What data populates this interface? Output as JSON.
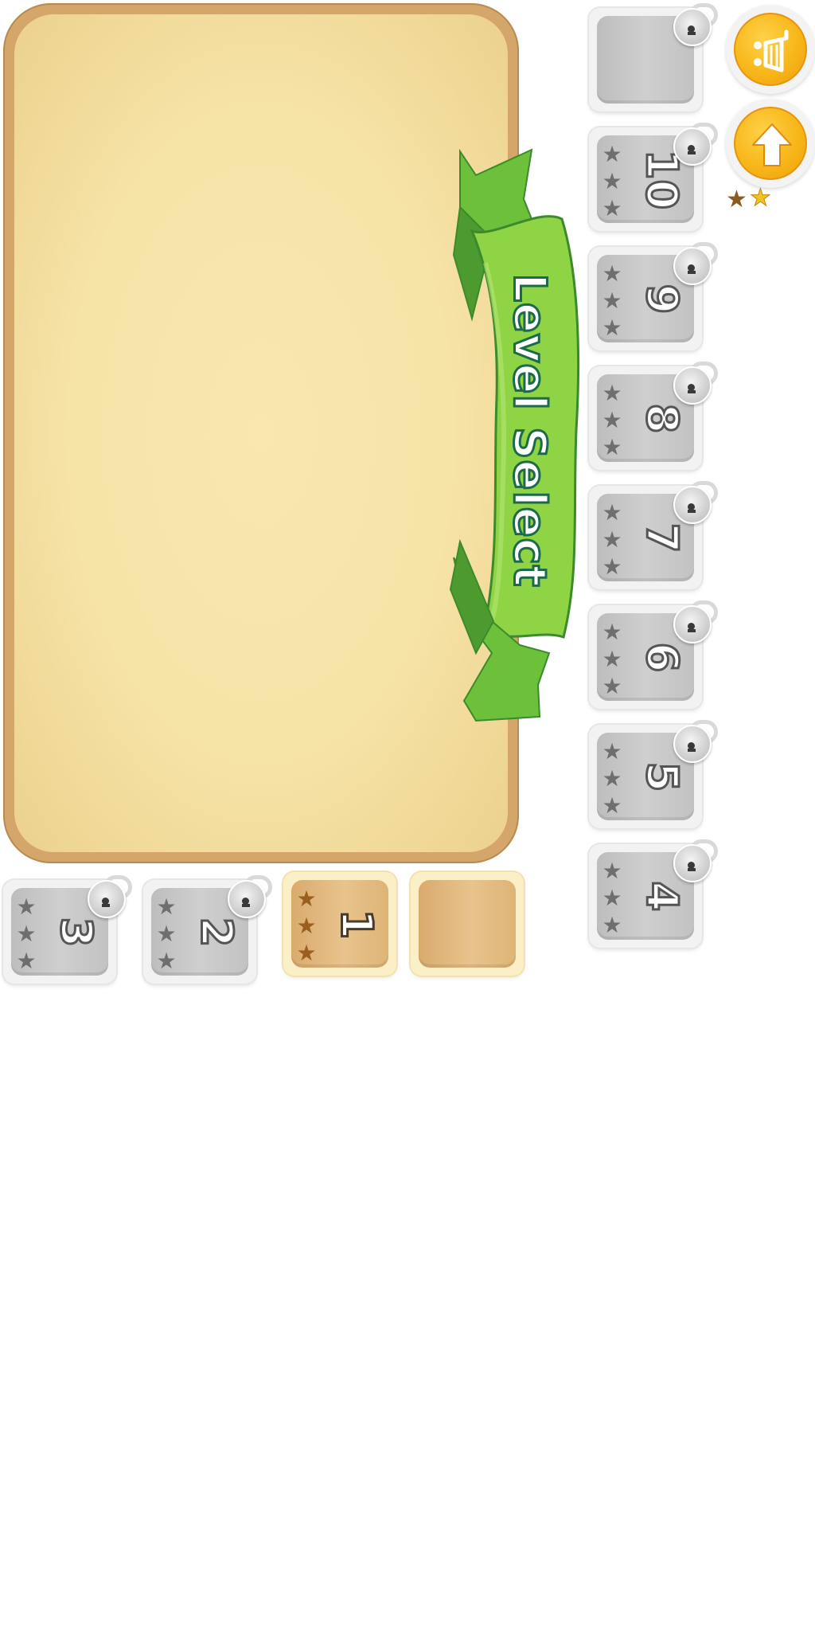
{
  "title": "Level Select",
  "levels": [
    {
      "number": "",
      "locked": true,
      "stars_earned": 0
    },
    {
      "number": "10",
      "locked": true,
      "stars_earned": 0
    },
    {
      "number": "9",
      "locked": true,
      "stars_earned": 0
    },
    {
      "number": "8",
      "locked": true,
      "stars_earned": 0
    },
    {
      "number": "7",
      "locked": true,
      "stars_earned": 0
    },
    {
      "number": "6",
      "locked": true,
      "stars_earned": 0
    },
    {
      "number": "5",
      "locked": true,
      "stars_earned": 0
    },
    {
      "number": "4",
      "locked": true,
      "stars_earned": 0
    },
    {
      "number": "3",
      "locked": true,
      "stars_earned": 0
    },
    {
      "number": "2",
      "locked": true,
      "stars_earned": 0
    },
    {
      "number": "1",
      "locked": false,
      "stars_earned": 0
    },
    {
      "number": "",
      "locked": false,
      "stars_earned": 0
    }
  ],
  "buttons": {
    "shop_icon": "shopping-cart-icon",
    "up_icon": "arrow-up-icon"
  },
  "star_glyph": "★",
  "rating_stars": {
    "filled": 1,
    "outline": 1
  },
  "colors": {
    "panel_border": "#d4a66a",
    "panel_fill": "#f6e3a6",
    "ribbon_green": "#7dc63d",
    "ribbon_text_stroke": "#1d6a4b",
    "button_orange": "#f7b719",
    "locked_tile": "#c7c7c7",
    "unlocked_tile": "#e3b880",
    "star_brown": "#8a5a1e",
    "star_yellow": "#f4c21f"
  }
}
